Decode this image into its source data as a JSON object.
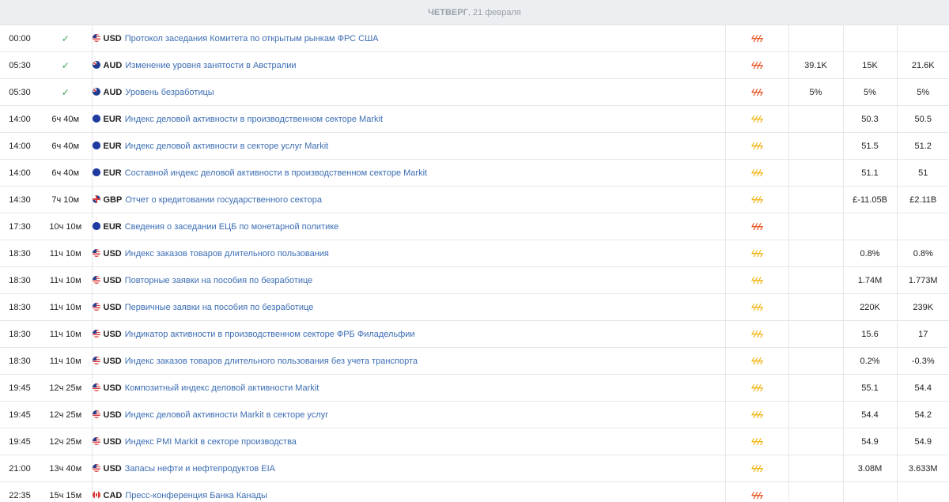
{
  "day_header": {
    "weekday": "ЧЕТВЕРГ",
    "date": ", 21 февраля"
  },
  "events": [
    {
      "time": "00:00",
      "remaining": "",
      "done": true,
      "flag": "us",
      "currency": "USD",
      "title": "Протокол заседания Комитета по открытым рынкам ФРС США",
      "importance": "high",
      "actual": "",
      "forecast": "",
      "previous": ""
    },
    {
      "time": "05:30",
      "remaining": "",
      "done": true,
      "flag": "au",
      "currency": "AUD",
      "title": "Изменение уровня занятости в Австралии",
      "importance": "high",
      "actual": "39.1K",
      "forecast": "15K",
      "previous": "21.6K"
    },
    {
      "time": "05:30",
      "remaining": "",
      "done": true,
      "flag": "au",
      "currency": "AUD",
      "title": "Уровень безработицы",
      "importance": "high",
      "actual": "5%",
      "forecast": "5%",
      "previous": "5%"
    },
    {
      "time": "14:00",
      "remaining": "6ч 40м",
      "done": false,
      "flag": "eu",
      "currency": "EUR",
      "title": "Индекс деловой активности в производственном секторе Markit",
      "importance": "medium",
      "actual": "",
      "forecast": "50.3",
      "previous": "50.5"
    },
    {
      "time": "14:00",
      "remaining": "6ч 40м",
      "done": false,
      "flag": "eu",
      "currency": "EUR",
      "title": "Индекс деловой активности в секторе услуг Markit",
      "importance": "medium",
      "actual": "",
      "forecast": "51.5",
      "previous": "51.2"
    },
    {
      "time": "14:00",
      "remaining": "6ч 40м",
      "done": false,
      "flag": "eu",
      "currency": "EUR",
      "title": "Составной индекс деловой активности в производственном секторе Markit",
      "importance": "medium",
      "actual": "",
      "forecast": "51.1",
      "previous": "51"
    },
    {
      "time": "14:30",
      "remaining": "7ч 10м",
      "done": false,
      "flag": "gb",
      "currency": "GBP",
      "title": "Отчет о кредитовании государственного сектора",
      "importance": "medium",
      "actual": "",
      "forecast": "£-11.05B",
      "previous": "£2.11B"
    },
    {
      "time": "17:30",
      "remaining": "10ч 10м",
      "done": false,
      "flag": "eu",
      "currency": "EUR",
      "title": "Сведения о заседании ЕЦБ по монетарной политике",
      "importance": "high",
      "actual": "",
      "forecast": "",
      "previous": ""
    },
    {
      "time": "18:30",
      "remaining": "11ч 10м",
      "done": false,
      "flag": "us",
      "currency": "USD",
      "title": "Индекс заказов товаров длительного пользования",
      "importance": "medium",
      "actual": "",
      "forecast": "0.8%",
      "previous": "0.8%"
    },
    {
      "time": "18:30",
      "remaining": "11ч 10м",
      "done": false,
      "flag": "us",
      "currency": "USD",
      "title": "Повторные заявки на пособия по безработице",
      "importance": "medium",
      "actual": "",
      "forecast": "1.74M",
      "previous": "1.773M"
    },
    {
      "time": "18:30",
      "remaining": "11ч 10м",
      "done": false,
      "flag": "us",
      "currency": "USD",
      "title": "Первичные заявки на пособия по безработице",
      "importance": "medium",
      "actual": "",
      "forecast": "220K",
      "previous": "239K"
    },
    {
      "time": "18:30",
      "remaining": "11ч 10м",
      "done": false,
      "flag": "us",
      "currency": "USD",
      "title": "Индикатор активности в производственном секторе ФРБ Филадельфии",
      "importance": "medium",
      "actual": "",
      "forecast": "15.6",
      "previous": "17"
    },
    {
      "time": "18:30",
      "remaining": "11ч 10м",
      "done": false,
      "flag": "us",
      "currency": "USD",
      "title": "Индекс заказов товаров длительного пользования без учета транспорта",
      "importance": "medium",
      "actual": "",
      "forecast": "0.2%",
      "previous": "-0.3%"
    },
    {
      "time": "19:45",
      "remaining": "12ч 25м",
      "done": false,
      "flag": "us",
      "currency": "USD",
      "title": "Композитный индекс деловой активности Markit",
      "importance": "medium",
      "actual": "",
      "forecast": "55.1",
      "previous": "54.4"
    },
    {
      "time": "19:45",
      "remaining": "12ч 25м",
      "done": false,
      "flag": "us",
      "currency": "USD",
      "title": "Индекс деловой активности Markit в секторе услуг",
      "importance": "medium",
      "actual": "",
      "forecast": "54.4",
      "previous": "54.2"
    },
    {
      "time": "19:45",
      "remaining": "12ч 25м",
      "done": false,
      "flag": "us",
      "currency": "USD",
      "title": "Индекс PMI Markit в секторе производства",
      "importance": "medium",
      "actual": "",
      "forecast": "54.9",
      "previous": "54.9"
    },
    {
      "time": "21:00",
      "remaining": "13ч 40м",
      "done": false,
      "flag": "us",
      "currency": "USD",
      "title": "Запасы нефти и нефтепродуктов EIA",
      "importance": "medium",
      "actual": "",
      "forecast": "3.08M",
      "previous": "3.633M"
    },
    {
      "time": "22:35",
      "remaining": "15ч 15м",
      "done": false,
      "flag": "ca",
      "currency": "CAD",
      "title": "Пресс-конференция Банка Канады",
      "importance": "high",
      "actual": "",
      "forecast": "",
      "previous": ""
    }
  ],
  "icons": {
    "done": "check-icon",
    "importance": "lightning-icon"
  },
  "colors": {
    "link": "#3b6db3",
    "check": "#3aa655",
    "importance_high": "#e85a2a",
    "importance_medium": "#f2b81f",
    "header_bg": "#eceef1"
  }
}
